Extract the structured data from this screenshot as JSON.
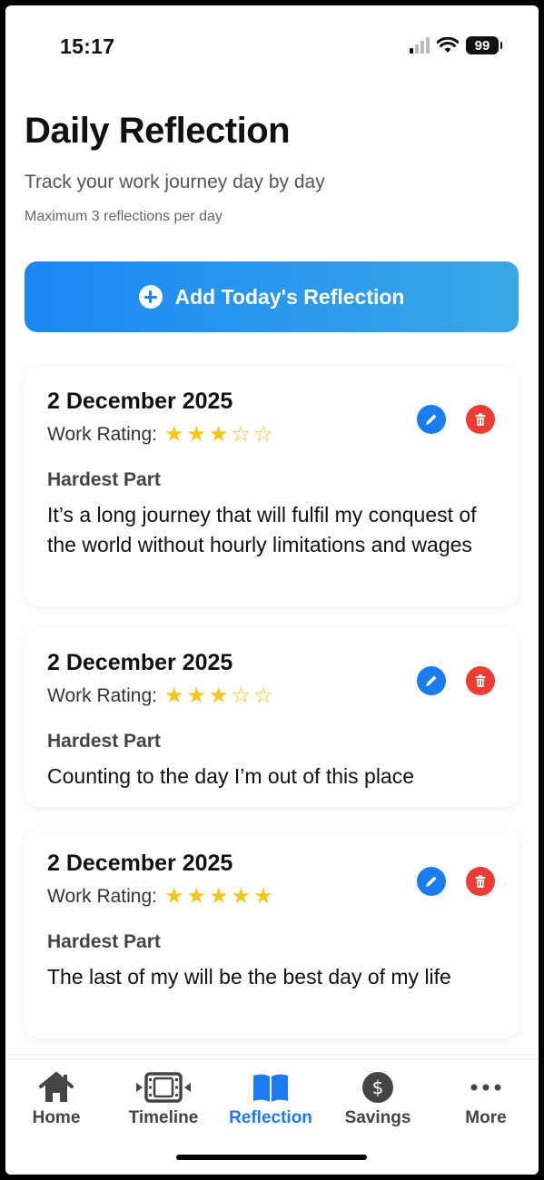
{
  "status_bar": {
    "time": "15:17",
    "battery": "99"
  },
  "header": {
    "title": "Daily Reflection",
    "subtitle": "Track your work journey day by day",
    "note": "Maximum 3 reflections per day"
  },
  "add_button": {
    "label": "Add Today's Reflection"
  },
  "reflections": [
    {
      "date": "2 December 2025",
      "rating_label": "Work Rating:",
      "rating": 3,
      "rating_max": 5,
      "section_label": "Hardest Part",
      "text": "It’s a long  journey that will fulfil my conquest of the world without hourly limitations and wages"
    },
    {
      "date": "2 December 2025",
      "rating_label": "Work Rating:",
      "rating": 3,
      "rating_max": 5,
      "section_label": "Hardest Part",
      "text": "Counting to the day I’m out of this place"
    },
    {
      "date": "2 December 2025",
      "rating_label": "Work Rating:",
      "rating": 5,
      "rating_max": 5,
      "section_label": "Hardest Part",
      "text": "The last of my will be the best day of my life"
    }
  ],
  "tabs": [
    {
      "label": "Home",
      "icon": "house-icon",
      "active": false
    },
    {
      "label": "Timeline",
      "icon": "film-strip-icon",
      "active": false
    },
    {
      "label": "Reflection",
      "icon": "book-icon",
      "active": true
    },
    {
      "label": "Savings",
      "icon": "dollar-circle-icon",
      "active": false
    },
    {
      "label": "More",
      "icon": "ellipsis-icon",
      "active": false
    }
  ],
  "colors": {
    "accent": "#1a7cf0",
    "delete": "#ee3b33",
    "star": "#f5c518",
    "gradient_start": "#1a87f5",
    "gradient_end": "#3aa7e6"
  }
}
